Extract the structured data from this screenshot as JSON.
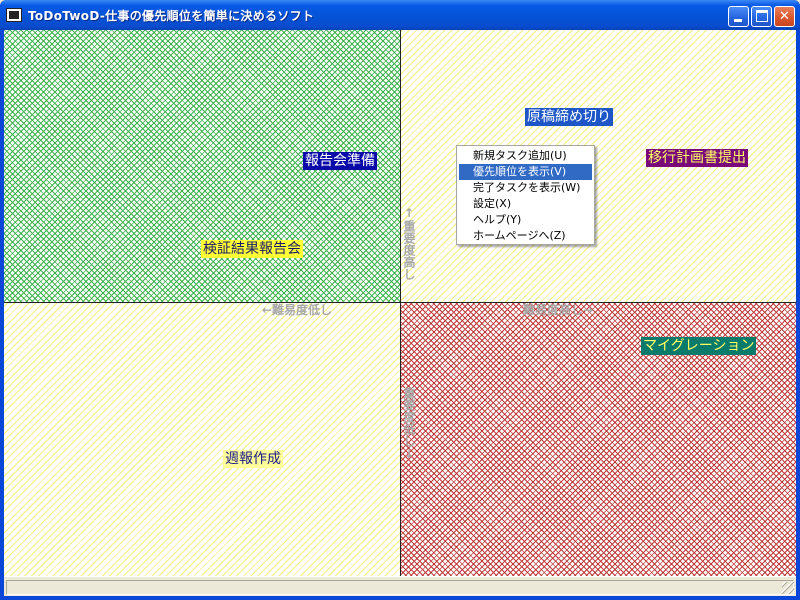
{
  "window": {
    "title": "ToDoTwoD-仕事の優先順位を簡単に決めるソフト",
    "minimize_symbol": "",
    "maximize_symbol": "",
    "close_symbol": "✕"
  },
  "axes": {
    "importance_high": "↑重要度高し",
    "importance_low": "重要度低し↓",
    "ease_low": "←難易度低し",
    "ease_high": "難易度高し→"
  },
  "quadrants": {
    "top_left_color": "#3cb24a",
    "top_right_color": "#f2ef7a",
    "bottom_left_color": "#f2ef7a",
    "bottom_right_color": "#c03a3a"
  },
  "tasks": [
    {
      "label": "報告会準備",
      "bg": "#0a0aa8",
      "fg": "#ffffff"
    },
    {
      "label": "検証結果報告会",
      "bg": "#ffff33",
      "fg": "#1a1a6a"
    },
    {
      "label": "原稿締め切り",
      "bg": "#1e56c8",
      "fg": "#ffffff"
    },
    {
      "label": "移行計画書提出",
      "bg": "#7a0a7a",
      "fg": "#ffff66"
    },
    {
      "label": "マイグレーション",
      "bg": "#0a7a6a",
      "fg": "#ffff66"
    },
    {
      "label": "週報作成",
      "bg": "#ffff99",
      "fg": "#1a1a8a"
    }
  ],
  "context_menu": {
    "items": [
      {
        "label": "新規タスク追加(U)",
        "selected": false
      },
      {
        "label": "優先順位を表示(V)",
        "selected": true
      },
      {
        "label": "完了タスクを表示(W)",
        "selected": false
      },
      {
        "label": "設定(X)",
        "selected": false
      },
      {
        "label": "ヘルプ(Y)",
        "selected": false
      },
      {
        "label": "ホームページへ(Z)",
        "selected": false
      }
    ]
  },
  "statusbar": {
    "text": ""
  }
}
